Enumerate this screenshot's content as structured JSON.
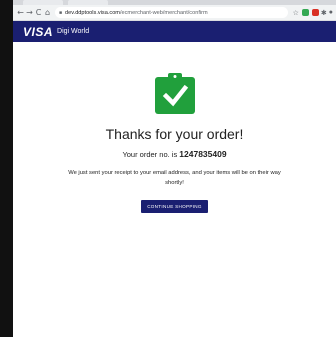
{
  "browser": {
    "url_host": "dev.ddptools.visa.com",
    "url_path": "/ecmerchant-web/merchant/confirm"
  },
  "header": {
    "brand": "VISA",
    "title": "Digi World"
  },
  "confirmation": {
    "title": "Thanks for your order!",
    "order_prefix": "Your order no. is ",
    "order_number": "1247835409",
    "message": "We just sent your receipt to your email address, and your items will be on their way shortly!",
    "button_label": "CONTINUE SHOPPING"
  },
  "colors": {
    "brand_navy": "#1a1f71",
    "success_green": "#21a03c"
  },
  "icons": {
    "confirmation": "clipboard-check-icon"
  }
}
